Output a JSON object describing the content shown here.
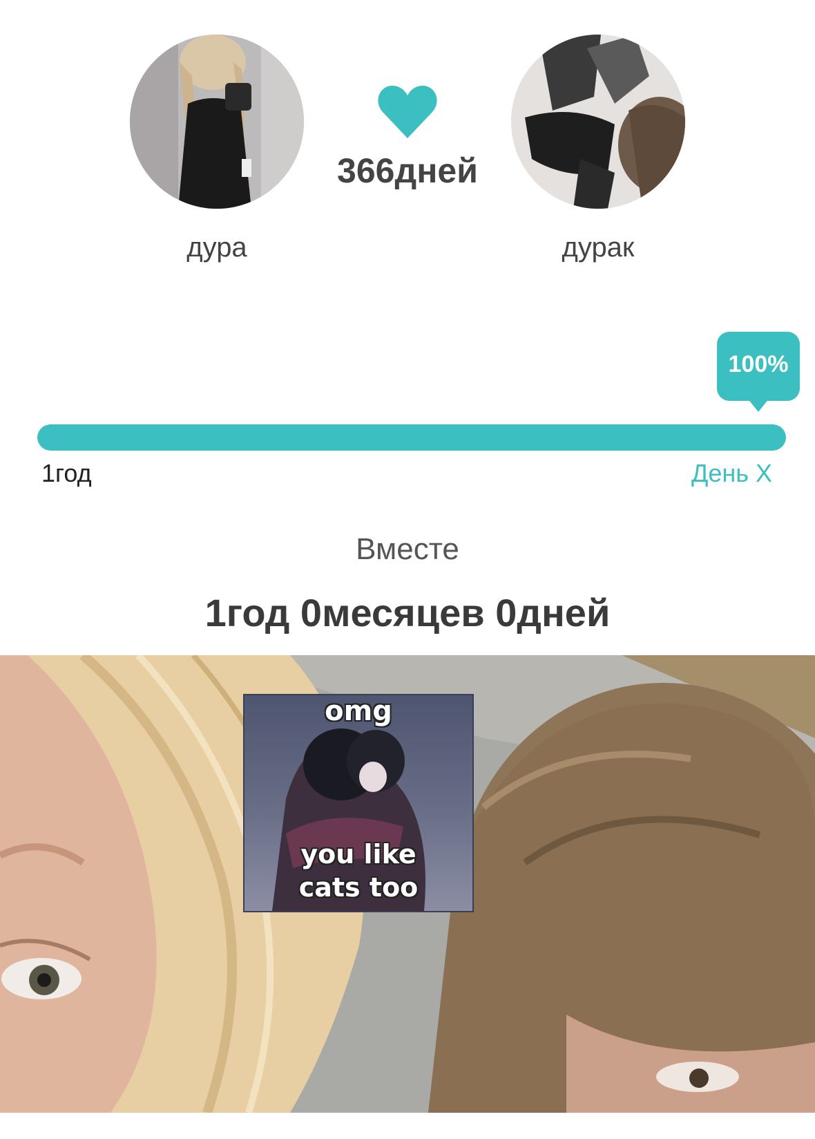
{
  "couple": {
    "left": {
      "name": "дура",
      "avatar": "girl-mirror-selfie-photo"
    },
    "right": {
      "name": "дурак",
      "avatar": "boy-photo"
    },
    "days_count": "366дней",
    "heart_icon": "heart-icon",
    "accent_color": "#3cbfc1"
  },
  "progress": {
    "percent_label": "100%",
    "fraction": 1.0,
    "start_label": "1год",
    "end_label": "День X"
  },
  "together": {
    "label": "Вместе",
    "duration": "1год 0месяцев 0дней"
  },
  "cover": {
    "photo": "couple-selfie-photo",
    "sticker": {
      "top_text": "omg",
      "bottom_line_1": "you like",
      "bottom_line_2": "cats too"
    }
  }
}
